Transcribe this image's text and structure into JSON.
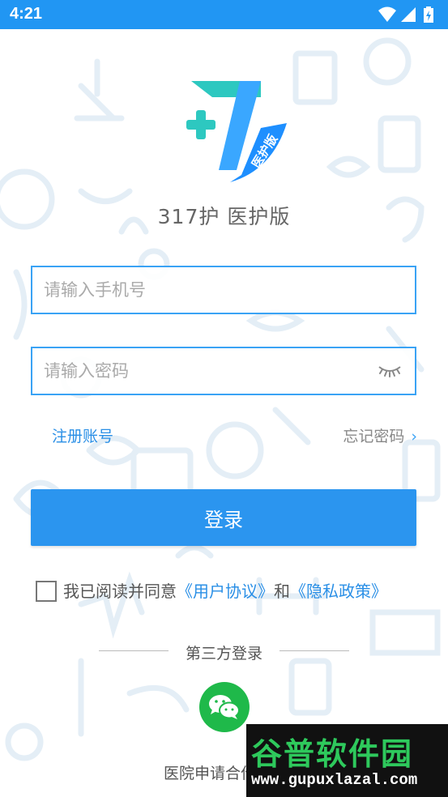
{
  "status_bar": {
    "time": "4:21",
    "icons": [
      "wifi-icon",
      "signal-icon",
      "battery-charging-icon"
    ],
    "color": "#2196f3"
  },
  "app": {
    "title": "317护 医护版",
    "logo_badge": "医护版",
    "brand_colors": {
      "teal": "#2dc8c0",
      "blue": "#3aa7ff"
    }
  },
  "form": {
    "phone_placeholder": "请输入手机号",
    "phone_value": "",
    "password_placeholder": "请输入密码",
    "password_value": "",
    "password_toggle_icon": "eye-closed-icon"
  },
  "links": {
    "register": "注册账号",
    "forgot_password": "忘记密码",
    "forgot_chevron": "›"
  },
  "login_button": "登录",
  "agreement": {
    "prefix": "我已阅读并同意",
    "user_agreement": "《用户协议》",
    "and": "和",
    "privacy_policy": "《隐私政策》",
    "checked": false
  },
  "third_party": {
    "label": "第三方登录",
    "wechat_icon": "wechat-icon"
  },
  "hospital_link": "医院申请合作",
  "watermark": {
    "title": "谷普软件园",
    "url": "www.gupuxlazal.com"
  },
  "accent_color": "#2b95ef"
}
